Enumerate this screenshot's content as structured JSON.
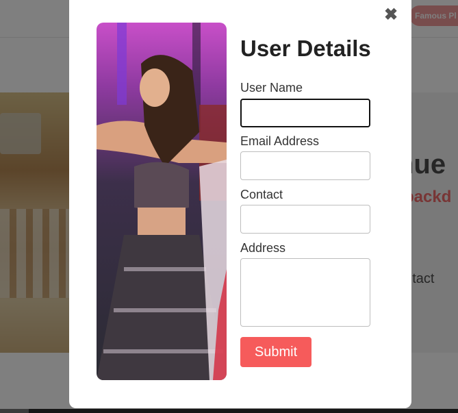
{
  "background": {
    "pill_label": "Famous Pl",
    "venue_title": "nue",
    "venue_subtitle": "backd",
    "contact_text": "ontact"
  },
  "modal": {
    "close_icon": "close-icon",
    "close_glyph": "✖",
    "title": "User Details",
    "fields": {
      "user_name": {
        "label": "User Name",
        "value": "",
        "placeholder": ""
      },
      "email": {
        "label": "Email Address",
        "value": "",
        "placeholder": ""
      },
      "contact": {
        "label": "Contact",
        "value": "",
        "placeholder": ""
      },
      "address": {
        "label": "Address",
        "value": "",
        "placeholder": ""
      }
    },
    "submit_label": "Submit"
  },
  "colors": {
    "accent": "#f65b5b",
    "overlay": "rgba(0,0,0,0.5)",
    "venue_subtitle": "#f06a6a"
  }
}
